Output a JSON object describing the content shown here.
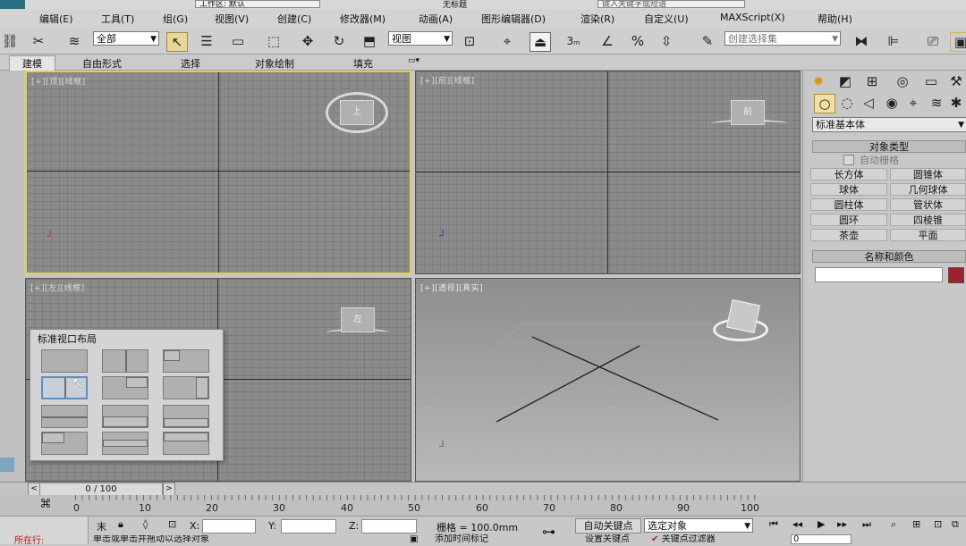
{
  "title": {
    "workspace": "工作区: 默认",
    "doc": "无标题",
    "search_placeholder": "键入关键字或短语"
  },
  "menu": [
    "编辑(E)",
    "工具(T)",
    "组(G)",
    "视图(V)",
    "创建(C)",
    "修改器(M)",
    "动画(A)",
    "图形编辑器(D)",
    "渲染(R)",
    "自定义(U)",
    "MAXScript(X)",
    "帮助(H)"
  ],
  "toolbar": {
    "filter": "全部",
    "ref_coord": "视图",
    "snap3": "3",
    "selection_set_placeholder": "创建选择集"
  },
  "ribbon_tabs": [
    "建模",
    "自由形式",
    "选择",
    "对象绘制",
    "填充"
  ],
  "viewports": {
    "top_label": "[+][顶][线框]",
    "front_label": "[+][前][线框]",
    "left_label": "[+][左][线框]",
    "persp_label": "[+][透视][真实]",
    "top_cube": "上",
    "front_cube": "前",
    "left_cube": "左"
  },
  "command_panel": {
    "category": "标准基本体",
    "object_type_header": "对象类型",
    "autogrid": "自动栅格",
    "buttons": [
      [
        "长方体",
        "圆锥体"
      ],
      [
        "球体",
        "几何球体"
      ],
      [
        "圆柱体",
        "管状体"
      ],
      [
        "圆环",
        "四棱锥"
      ],
      [
        "茶壶",
        "平面"
      ]
    ],
    "name_color_header": "名称和颜色",
    "object_color": "#a0202e"
  },
  "layout_popup": {
    "title": "标准视口布局"
  },
  "timeline": {
    "slider": "0 / 100",
    "ticks": [
      "0",
      "10",
      "20",
      "30",
      "40",
      "50",
      "60",
      "70",
      "80",
      "90",
      "100"
    ]
  },
  "status": {
    "status_prefix": "所在行:",
    "prompt": "单击或单击并拖动以选择对象",
    "add_time_tag": "添加时间标记",
    "last_field": "末",
    "x_label": "X:",
    "y_label": "Y:",
    "z_label": "Z:",
    "grid": "栅格 = 100.0mm",
    "auto_key": "自动关键点",
    "set_key": "设置关键点",
    "key_target": "选定对象",
    "key_filter": "关键点过滤器",
    "frame": "0"
  }
}
